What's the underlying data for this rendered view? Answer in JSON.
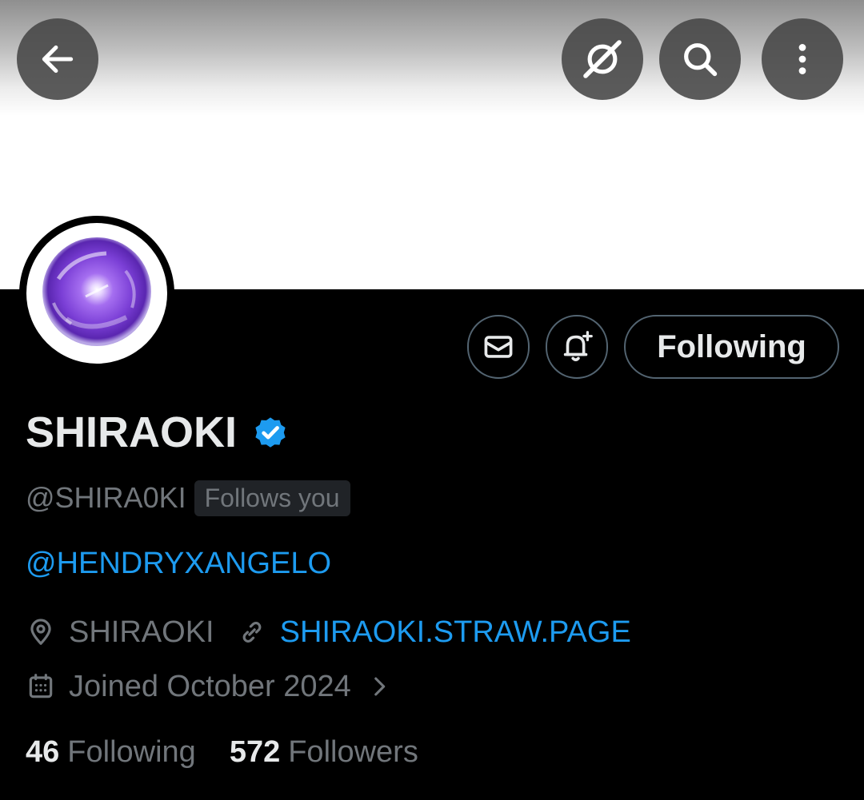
{
  "header": {
    "back_icon": "arrow-left-icon",
    "grok_icon": "grok-icon",
    "search_icon": "search-icon",
    "more_icon": "more-vertical-icon"
  },
  "profile": {
    "display_name": "SHIRAOKI",
    "verified": true,
    "verified_color": "#1d9bf0",
    "handle": "@SHIRA0KI",
    "follows_you": "Follows you",
    "bio_mention": "@HENDRYXANGELO",
    "location": "SHIRAOKI",
    "website": "SHIRAOKI.STRAW.PAGE",
    "joined": "Joined October 2024",
    "following_count": "46",
    "following_label": "Following",
    "followers_count": "572",
    "followers_label": "Followers"
  },
  "actions": {
    "message_icon": "mail-icon",
    "notify_icon": "bell-plus-icon",
    "follow_state": "Following"
  },
  "colors": {
    "background": "#000000",
    "accent": "#1d9bf0",
    "text_primary": "#e7e9ea",
    "text_secondary": "#71767b",
    "avatar_orb": "#7b3fd6"
  }
}
